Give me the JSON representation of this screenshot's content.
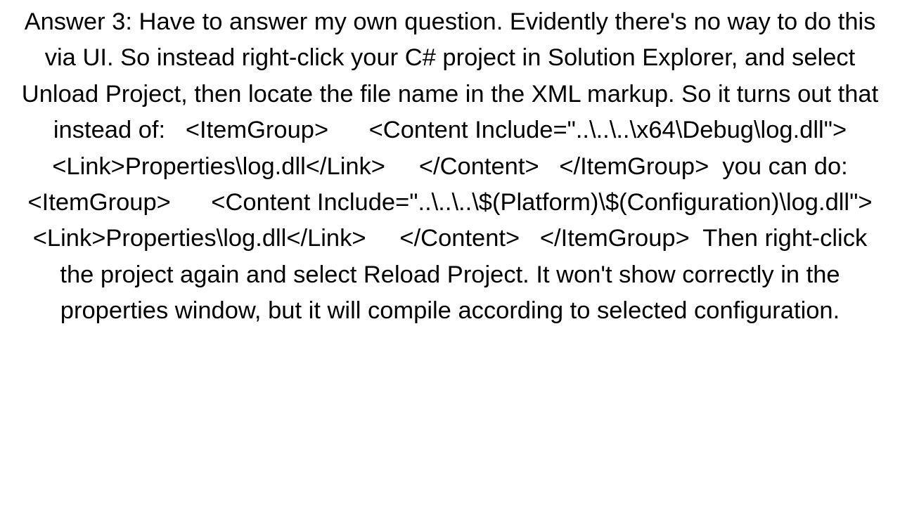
{
  "answer": {
    "text": "Answer 3: Have to answer my own question. Evidently there's no way to do this via UI. So instead right-click your C# project in Solution Explorer, and select Unload Project, then locate the file name in the XML markup. So it turns out that instead of:   <ItemGroup>      <Content Include=\"..\\..\\..\\x64\\Debug\\log.dll\">       <Link>Properties\\log.dll</Link>     </Content>   </ItemGroup>  you can do:   <ItemGroup>      <Content Include=\"..\\..\\..\\$(Platform)\\$(Configuration)\\log.dll\">       <Link>Properties\\log.dll</Link>     </Content>   </ItemGroup>  Then right-click the project again and select Reload Project. It won't show correctly in the properties window, but it will compile according to selected configuration."
  }
}
